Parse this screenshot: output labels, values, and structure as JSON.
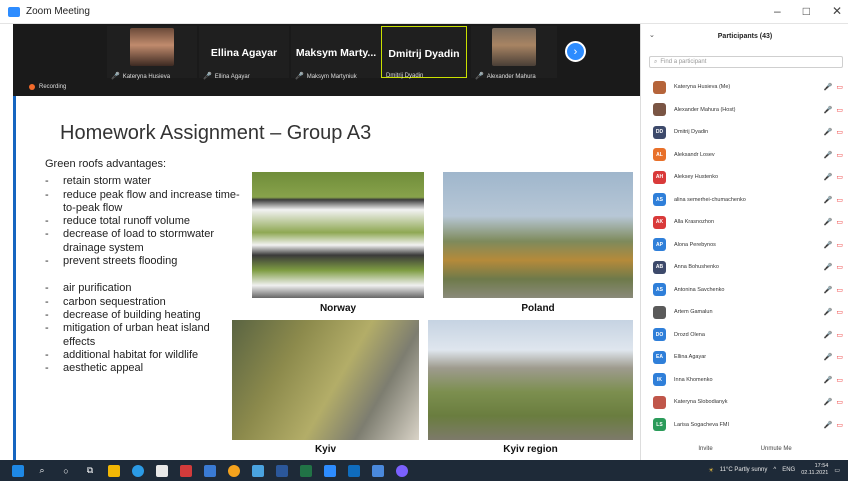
{
  "window": {
    "title": "Zoom Meeting",
    "minimize": "–",
    "maximize": "□",
    "close": "✕"
  },
  "strip": {
    "tiles": [
      {
        "big_name": "",
        "footer": "Kateryna Husieva"
      },
      {
        "big_name": "Ellina Agayar",
        "footer": "Ellina Agayar"
      },
      {
        "big_name": "Maksym Marty...",
        "footer": "Maksym Martyniuk"
      },
      {
        "big_name": "Dmitrij Dyadin",
        "footer": "Dmitrij Dyadin"
      },
      {
        "big_name": "",
        "footer": "Alexander Mahura"
      }
    ],
    "next_icon": "›",
    "recording": "Recording"
  },
  "slide": {
    "title": "Homework Assignment – Group A3",
    "heading": "Green roofs advantages:",
    "items_a": [
      "retain storm water",
      "reduce peak flow and increase time-to-peak flow",
      "reduce total runoff volume",
      "decrease of load to stormwater drainage system",
      "prevent streets flooding"
    ],
    "items_b": [
      "air purification",
      "carbon sequestration",
      "decrease of building heating",
      "mitigation of urban heat island effects",
      "additional habitat for wildlife",
      "aesthetic appeal"
    ],
    "captions": {
      "norway": "Norway",
      "poland": "Poland",
      "kyiv": "Kyiv",
      "kyiv_region": "Kyiv region"
    }
  },
  "participants": {
    "title": "Participants (43)",
    "search_placeholder": "Find a participant",
    "list": [
      {
        "initials": "",
        "name": "Kateryna Husieva (Me)",
        "color": "#b5643a"
      },
      {
        "initials": "",
        "name": "Alexander Mahura (Host)",
        "color": "#7a5544"
      },
      {
        "initials": "DD",
        "name": "Dmitrij Dyadin",
        "color": "#3d4a6b"
      },
      {
        "initials": "AL",
        "name": "Aleksandr Losev",
        "color": "#e8702a"
      },
      {
        "initials": "AH",
        "name": "Aleksey Hustenko",
        "color": "#d93a3a"
      },
      {
        "initials": "AS",
        "name": "alina semerhei-chumachenko",
        "color": "#2f7fd9"
      },
      {
        "initials": "AK",
        "name": "Alla Krasnozhon",
        "color": "#d93a3a"
      },
      {
        "initials": "AP",
        "name": "Alona Perebynos",
        "color": "#2f7fd9"
      },
      {
        "initials": "AB",
        "name": "Anna Bohushenko",
        "color": "#3d4a6b"
      },
      {
        "initials": "AS",
        "name": "Antonina Savchenko",
        "color": "#2f7fd9"
      },
      {
        "initials": "",
        "name": "Artem Gamalun",
        "color": "#5a5a5a"
      },
      {
        "initials": "DO",
        "name": "Drozd Olena",
        "color": "#2f7fd9"
      },
      {
        "initials": "EA",
        "name": "Ellina Agayar",
        "color": "#2f7fd9"
      },
      {
        "initials": "IK",
        "name": "Inna Khomenko",
        "color": "#2f7fd9"
      },
      {
        "initials": "",
        "name": "Kateryna Slobodianyk",
        "color": "#c0564a"
      },
      {
        "initials": "LS",
        "name": "Larisa Sogacheva FMI",
        "color": "#2b9b5a"
      }
    ],
    "invite": "Invite",
    "unmute": "Unmute Me"
  },
  "taskbar": {
    "weather": "11°C Partly sunny",
    "lang": "ENG",
    "time": "17:54",
    "date": "02.11.2021"
  }
}
